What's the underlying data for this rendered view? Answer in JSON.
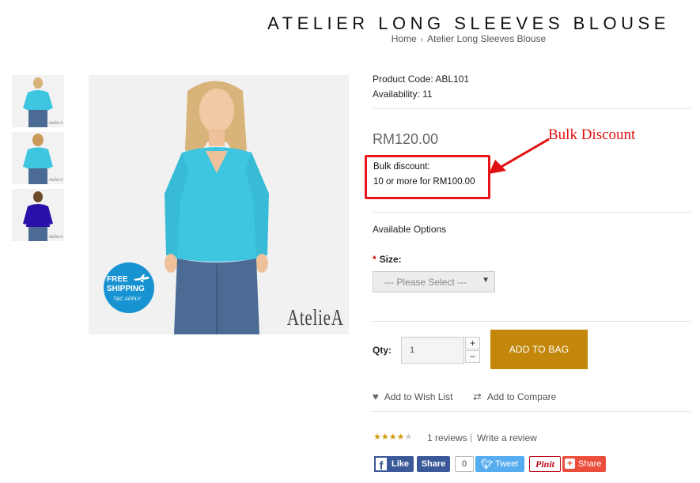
{
  "header": {
    "title": "ATELIER LONG SLEEVES BLOUSE",
    "breadcrumb": {
      "home": "Home",
      "separator": "›",
      "current": "Atelier Long Sleeves Blouse"
    }
  },
  "gallery": {
    "thumbnails": [
      {
        "alt": "turquoise blouse front",
        "color": "#3ec5e0",
        "watermark": "AtelieA"
      },
      {
        "alt": "turquoise blouse back",
        "color": "#3ec5e0",
        "watermark": "AtelieA"
      },
      {
        "alt": "purple blouse front",
        "color": "#2a10a8",
        "watermark": "AtelieA"
      }
    ],
    "main_image": {
      "blouse_color": "#3ec5e0",
      "badge": {
        "line1": "FREE",
        "line2": "SHIPPING",
        "line3": "T&C APPLY"
      },
      "watermark": "AtelieA"
    }
  },
  "product": {
    "code_label": "Product Code: ABL101",
    "availability_label": "Availability: 11",
    "price": "RM120.00",
    "bulk_discount": {
      "title": "Bulk discount:",
      "value": "10 or more for RM100.00"
    },
    "annotation": {
      "text": "Bulk Discount",
      "color": "#e01010"
    },
    "options_heading": "Available Options",
    "size": {
      "required_mark": "*",
      "label": "Size:",
      "selected": "--- Please Select ---"
    },
    "qty": {
      "label": "Qty:",
      "value": "1",
      "plus": "+",
      "minus": "−"
    },
    "add_to_bag": "ADD TO BAG",
    "accent_color": "#c2870b",
    "wishlist": "Add to Wish List",
    "compare": "Add to Compare",
    "rating": {
      "stars": 4,
      "max": 5,
      "reviews": "1 reviews",
      "separator": "|",
      "write": "Write a review"
    }
  },
  "social": {
    "fb_like": "Like",
    "fb_share": "Share",
    "share_count": "0",
    "tweet": "Tweet",
    "pinit": "Pinit",
    "share": "Share"
  }
}
